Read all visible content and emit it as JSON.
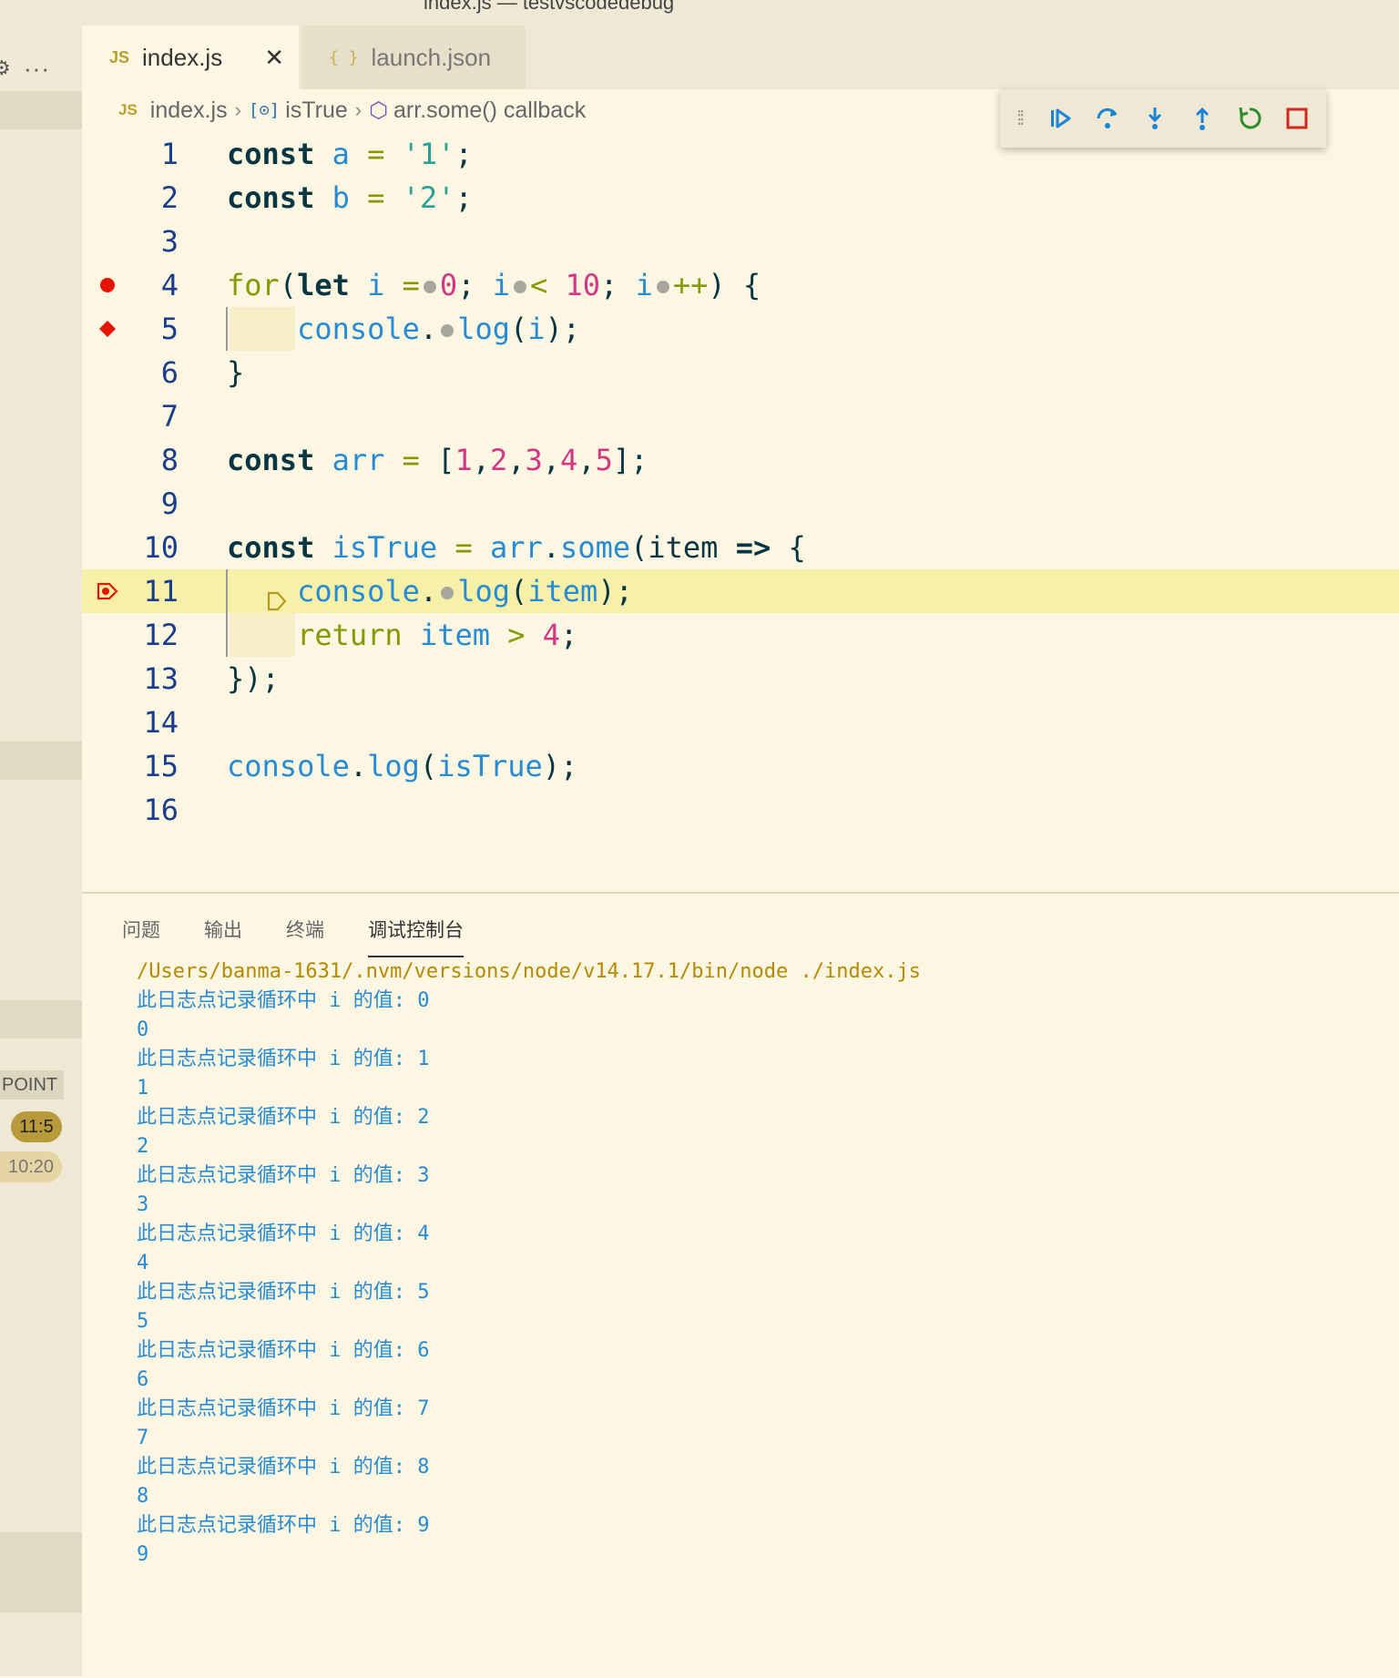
{
  "window": {
    "title": "index.js — testvscodedebug"
  },
  "tabs": [
    {
      "label": "index.js",
      "icon": "JS",
      "active": true
    },
    {
      "label": "launch.json",
      "icon": "{ }",
      "active": false
    }
  ],
  "breadcrumb": {
    "file": "index.js",
    "symbol1": "isTrue",
    "symbol2": "arr.some() callback"
  },
  "debug_toolbar": [
    "continue",
    "step-over",
    "step-into",
    "step-out",
    "restart",
    "stop"
  ],
  "sidebar": {
    "point_label": "POINT",
    "badge1": "11:5",
    "badge2": "10:20",
    "more": "···"
  },
  "editor": {
    "lines": [
      {
        "num": "1"
      },
      {
        "num": "2"
      },
      {
        "num": "3"
      },
      {
        "num": "4"
      },
      {
        "num": "5"
      },
      {
        "num": "6"
      },
      {
        "num": "7"
      },
      {
        "num": "8"
      },
      {
        "num": "9"
      },
      {
        "num": "10"
      },
      {
        "num": "11"
      },
      {
        "num": "12"
      },
      {
        "num": "13"
      },
      {
        "num": "14"
      },
      {
        "num": "15"
      },
      {
        "num": "16"
      }
    ],
    "tokens": {
      "const": "const",
      "a": "a",
      "b": "b",
      "eq": "=",
      "s1": "'1'",
      "s2": "'2'",
      "semi": ";",
      "for": "for",
      "let": "let",
      "i": "i",
      "zero": "0",
      "lt": "<",
      "ten": "10",
      "inc": "++",
      "console": "console",
      "log": "log",
      "arr": "arr",
      "isTrue": "isTrue",
      "some": "some",
      "item": "item",
      "arrow": "=>",
      "return": "return",
      "gt": ">",
      "four": "4",
      "n1": "1",
      "n2": "2",
      "n3": "3",
      "n4": "4",
      "n5": "5"
    }
  },
  "panel": {
    "tabs": [
      "问题",
      "输出",
      "终端",
      "调试控制台"
    ],
    "command": "/Users/banma-1631/.nvm/versions/node/v14.17.1/bin/node ./index.js",
    "output": [
      "此日志点记录循环中 i 的值: 0",
      "0",
      "此日志点记录循环中 i 的值: 1",
      "1",
      "此日志点记录循环中 i 的值: 2",
      "2",
      "此日志点记录循环中 i 的值: 3",
      "3",
      "此日志点记录循环中 i 的值: 4",
      "4",
      "此日志点记录循环中 i 的值: 5",
      "5",
      "此日志点记录循环中 i 的值: 6",
      "6",
      "此日志点记录循环中 i 的值: 7",
      "7",
      "此日志点记录循环中 i 的值: 8",
      "8",
      "此日志点记录循环中 i 的值: 9",
      "9"
    ]
  },
  "colors": {
    "background": "#fdf6e3",
    "breakpoint": "#e51400",
    "current_line": "#f6f0a8",
    "debug_accent": "#1a85d6"
  }
}
